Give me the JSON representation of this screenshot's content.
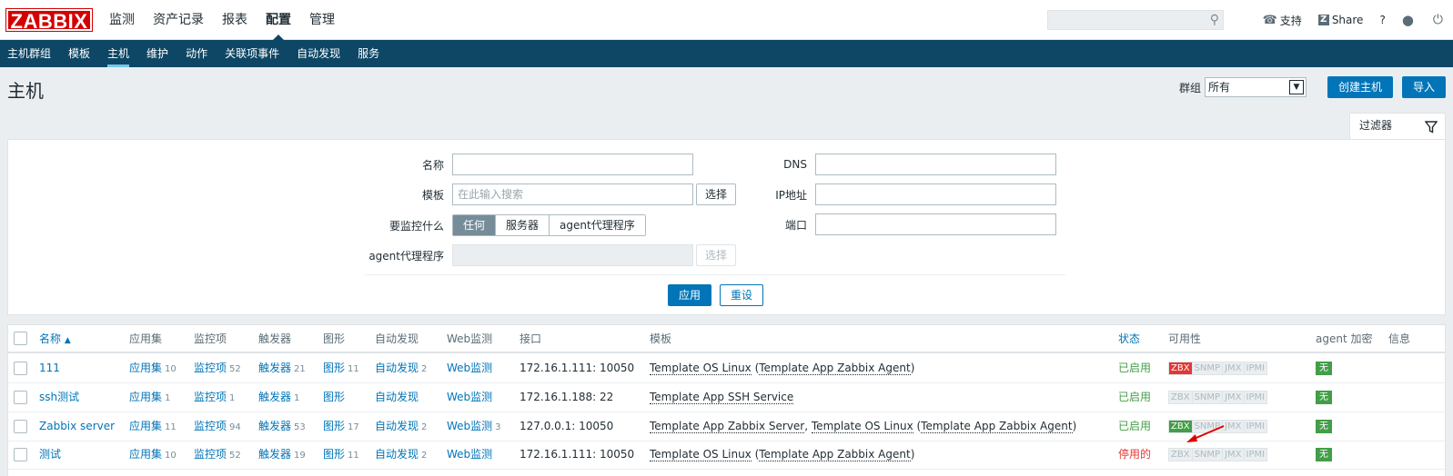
{
  "logo": "ZABBIX",
  "main_menu": [
    {
      "label": "监测",
      "active": false
    },
    {
      "label": "资产记录",
      "active": false
    },
    {
      "label": "报表",
      "active": false
    },
    {
      "label": "配置",
      "active": true
    },
    {
      "label": "管理",
      "active": false
    }
  ],
  "header_tools": {
    "support": "支持",
    "share": "Share",
    "share_badge": "Z",
    "help": "?"
  },
  "sub_menu": [
    {
      "label": "主机群组",
      "active": false
    },
    {
      "label": "模板",
      "active": false
    },
    {
      "label": "主机",
      "active": true
    },
    {
      "label": "维护",
      "active": false
    },
    {
      "label": "动作",
      "active": false
    },
    {
      "label": "关联项事件",
      "active": false
    },
    {
      "label": "自动发现",
      "active": false
    },
    {
      "label": "服务",
      "active": false
    }
  ],
  "page": {
    "title": "主机",
    "group_label": "群组",
    "group_value": "所有",
    "create_button": "创建主机",
    "import_button": "导入"
  },
  "filter": {
    "tab_label": "过滤器",
    "name_label": "名称",
    "name_value": "",
    "template_label": "模板",
    "template_placeholder": "在此输入搜索",
    "select_label": "选择",
    "monitor_label": "要监控什么",
    "monitor_options": [
      "任何",
      "服务器",
      "agent代理程序"
    ],
    "monitor_selected": "任何",
    "proxy_label": "agent代理程序",
    "dns_label": "DNS",
    "dns_value": "",
    "ip_label": "IP地址",
    "ip_value": "",
    "port_label": "端口",
    "port_value": "",
    "apply_button": "应用",
    "reset_button": "重设"
  },
  "table": {
    "columns": {
      "name": "名称",
      "sort_indicator": "▲",
      "apps": "应用集",
      "items": "监控项",
      "triggers": "触发器",
      "graphs": "图形",
      "discovery": "自动发现",
      "web": "Web监测",
      "interface": "接口",
      "templates": "模板",
      "status": "状态",
      "availability": "可用性",
      "encryption": "agent 加密",
      "info": "信息"
    },
    "rows": [
      {
        "name": "111",
        "apps": "应用集",
        "apps_count": "10",
        "items": "监控项",
        "items_count": "52",
        "triggers": "触发器",
        "triggers_count": "21",
        "graphs": "图形",
        "graphs_count": "11",
        "discovery": "自动发现",
        "discovery_count": "2",
        "web": "Web监测",
        "web_count": "",
        "interface": "172.16.1.111: 10050",
        "templates": [
          {
            "text": "Template OS Linux",
            "link": true
          },
          {
            "text": " (",
            "link": false
          },
          {
            "text": "Template App Zabbix Agent",
            "link": true
          },
          {
            "text": ")",
            "link": false
          }
        ],
        "status": "已启用",
        "status_ok": true,
        "availability": {
          "zbx": "red",
          "snmp": "off",
          "jmx": "off",
          "ipmi": "off"
        },
        "encryption": "无"
      },
      {
        "name": "ssh测试",
        "apps": "应用集",
        "apps_count": "1",
        "items": "监控项",
        "items_count": "1",
        "triggers": "触发器",
        "triggers_count": "1",
        "graphs": "图形",
        "graphs_count": "",
        "discovery": "自动发现",
        "discovery_count": "",
        "web": "Web监测",
        "web_count": "",
        "interface": "172.16.1.188: 22",
        "templates": [
          {
            "text": "Template App SSH Service",
            "link": true
          }
        ],
        "status": "已启用",
        "status_ok": true,
        "availability": {
          "zbx": "off",
          "snmp": "off",
          "jmx": "off",
          "ipmi": "off"
        },
        "encryption": "无"
      },
      {
        "name": "Zabbix server",
        "apps": "应用集",
        "apps_count": "11",
        "items": "监控项",
        "items_count": "94",
        "triggers": "触发器",
        "triggers_count": "53",
        "graphs": "图形",
        "graphs_count": "17",
        "discovery": "自动发现",
        "discovery_count": "2",
        "web": "Web监测",
        "web_count": "3",
        "interface": "127.0.0.1: 10050",
        "templates": [
          {
            "text": "Template App Zabbix Server",
            "link": true
          },
          {
            "text": ", ",
            "link": false
          },
          {
            "text": "Template OS Linux",
            "link": true
          },
          {
            "text": " (",
            "link": false
          },
          {
            "text": "Template App Zabbix Agent",
            "link": true
          },
          {
            "text": ")",
            "link": false
          }
        ],
        "status": "已启用",
        "status_ok": true,
        "availability": {
          "zbx": "green",
          "snmp": "off",
          "jmx": "off",
          "ipmi": "off"
        },
        "encryption": "无"
      },
      {
        "name": "测试",
        "apps": "应用集",
        "apps_count": "10",
        "items": "监控项",
        "items_count": "52",
        "triggers": "触发器",
        "triggers_count": "19",
        "graphs": "图形",
        "graphs_count": "11",
        "discovery": "自动发现",
        "discovery_count": "2",
        "web": "Web监测",
        "web_count": "",
        "interface": "172.16.1.111: 10050",
        "templates": [
          {
            "text": "Template OS Linux",
            "link": true
          },
          {
            "text": " (",
            "link": false
          },
          {
            "text": "Template App Zabbix Agent",
            "link": true
          },
          {
            "text": ")",
            "link": false
          }
        ],
        "status": "停用的",
        "status_ok": false,
        "availability": {
          "zbx": "off",
          "snmp": "off",
          "jmx": "off",
          "ipmi": "off"
        },
        "encryption": "无"
      }
    ],
    "availability_labels": [
      "ZBX",
      "SNMP",
      "JMX",
      "IPMI"
    ]
  },
  "colors": {
    "brand": "#d40000",
    "nav": "#0e4765",
    "link": "#0275b8",
    "ok": "#429e47",
    "error": "#e33734",
    "annotation": "#e00000"
  }
}
